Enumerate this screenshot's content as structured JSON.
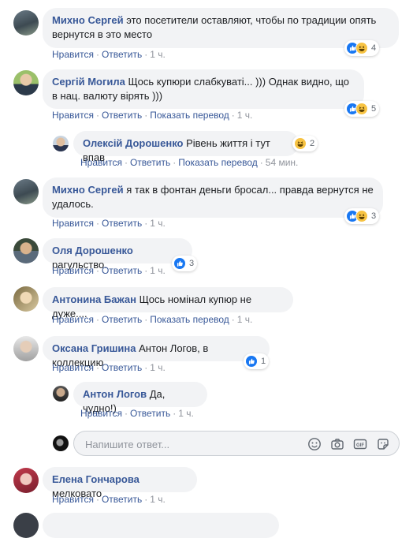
{
  "labels": {
    "like": "Нравится",
    "reply": "Ответить",
    "translate": "Показать перевод",
    "dot": "·"
  },
  "comments": [
    {
      "name": "Михно Сергей",
      "text": "это посетители оставляют, чтобы по традиции опять вернутся в это место",
      "time": "1 ч.",
      "reactions": "4"
    },
    {
      "name": "Сергій Могила",
      "text": "Щось купюри слабкуваті... ))) Однак видно, що в нац. валюту вірять )))",
      "time": "1 ч.",
      "reactions": "5"
    },
    {
      "name": "Олексій Дорошенко",
      "text": "Рівень життя і тут впав",
      "time": "54 мин.",
      "reactions": "2"
    },
    {
      "name": "Михно Сергей",
      "text": "я так в фонтан деньги бросал... правда вернутся не удалось.",
      "time": "1 ч.",
      "reactions": "3"
    },
    {
      "name": "Оля Дорошенко",
      "text": "рагульство.",
      "time": "1 ч.",
      "reactions": "3"
    },
    {
      "name": "Антонина Бажан",
      "text": "Щось номінал купюр не дуже....",
      "time": "1 ч."
    },
    {
      "name": "Оксана Гришина",
      "text": "Антон Логов, в коллекцию",
      "time": "1 ч.",
      "reactions": "1"
    },
    {
      "name": "Антон Логов",
      "text": "Да, чудно!)",
      "time": "1 ч."
    },
    {
      "name": "Елена Гончарова",
      "text": "мелковато",
      "time": "1 ч."
    }
  ],
  "reply_box": {
    "placeholder": "Напишите ответ..."
  },
  "icons": [
    "emoji-icon",
    "camera-icon",
    "gif-icon",
    "sticker-icon",
    "like-reaction-icon",
    "haha-reaction-icon"
  ],
  "colors": {
    "name": "#385898",
    "bubble": "#f2f3f5",
    "like": "#1877f2",
    "haha": "#f7c343",
    "meta": "#90949c"
  }
}
